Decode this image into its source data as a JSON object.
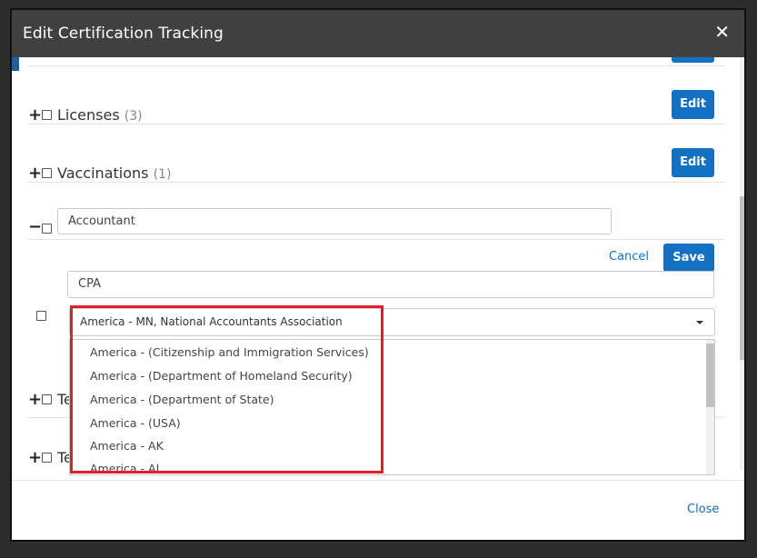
{
  "modal": {
    "title": "Edit Certification Tracking",
    "close_glyph": "✕"
  },
  "categories": [
    {
      "label": "Licenses",
      "count": "(3)",
      "edit_label": "Edit"
    },
    {
      "label": "Vaccinations",
      "count": "(1)",
      "edit_label": "Edit"
    }
  ],
  "expanded": {
    "toggle_glyph": "−",
    "name_value": "Accountant",
    "cancel_label": "Cancel",
    "save_label": "Save",
    "cert": {
      "name_value": "CPA",
      "issuer_selected": "America - MN, National Accountants Association",
      "issuer_options": [
        "America - (Citizenship and Immigration Services)",
        "America - (Department of Homeland Security)",
        "America - (Department of State)",
        "America - (USA)",
        "America - AK",
        "America - AL"
      ]
    }
  },
  "collapsed_rows": [
    {
      "toggle_glyph": "+",
      "partial_label": "Te"
    },
    {
      "toggle_glyph": "+",
      "partial_label": "Te"
    }
  ],
  "plus_glyph": "+",
  "footer": {
    "close_label": "Close"
  },
  "colors": {
    "accent": "#1470c2",
    "header_bg": "#404040",
    "highlight": "#e21e2e"
  }
}
